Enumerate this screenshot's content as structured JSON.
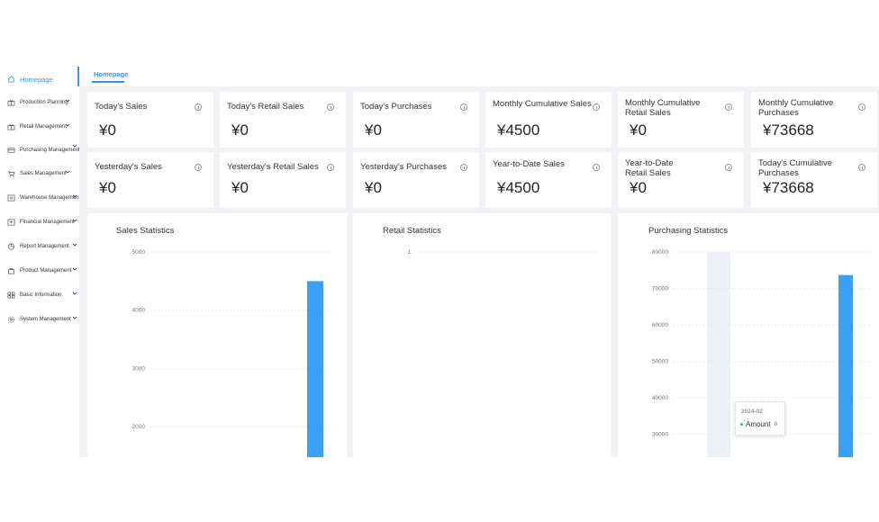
{
  "sidebar": {
    "items": [
      {
        "label": "Homepage",
        "icon": "home-icon",
        "active": true
      },
      {
        "label": "Production Planning",
        "icon": "gift-icon"
      },
      {
        "label": "Retail Management",
        "icon": "gift-icon"
      },
      {
        "label": "Purchasing Management",
        "icon": "card-icon"
      },
      {
        "label": "Sales Management",
        "icon": "cart-icon"
      },
      {
        "label": "Warehouse Management",
        "icon": "warehouse-icon"
      },
      {
        "label": "Financial Management",
        "icon": "finance-icon"
      },
      {
        "label": "Report Management",
        "icon": "pie-icon"
      },
      {
        "label": "Product Management",
        "icon": "bag-icon"
      },
      {
        "label": "Basic Information",
        "icon": "grid-icon"
      },
      {
        "label": "System Management",
        "icon": "settings-icon"
      }
    ]
  },
  "tabs": [
    {
      "label": "Homepage"
    }
  ],
  "cards": [
    {
      "label": "Today's Sales",
      "value": "¥0"
    },
    {
      "label": "Today's Retail Sales",
      "value": "¥0"
    },
    {
      "label": "Today's Purchases",
      "value": "¥0"
    },
    {
      "label": "Monthly Cumulative Sales",
      "value": "¥4500"
    },
    {
      "label": "Monthly Cumulative Retail Sales",
      "value": "¥0"
    },
    {
      "label": "Monthly Cumulative Purchases",
      "value": "¥73668"
    },
    {
      "label": "Yesterday's Sales",
      "value": "¥0"
    },
    {
      "label": "Yesterday's Retail Sales",
      "value": "¥0"
    },
    {
      "label": "Yesterday's Purchases",
      "value": "¥0"
    },
    {
      "label": "Year-to-Date Sales",
      "value": "¥4500"
    },
    {
      "label": "Year-to-Date Retail Sales",
      "value": "¥0"
    },
    {
      "label": "Today's Cumulative Purchases",
      "value": "¥73668"
    }
  ],
  "colors": {
    "accent": "#3d8ff2",
    "bar": "#3a9ff6",
    "background": "#f0f2f5"
  },
  "chart_data": [
    {
      "type": "bar",
      "title": "Sales Statistics",
      "ylim": [
        2000,
        5000
      ],
      "ticks": [
        5000,
        4000,
        3000,
        2000
      ],
      "series": [
        {
          "values": [
            4500
          ]
        }
      ],
      "grid": true
    },
    {
      "type": "bar",
      "title": "Retail Statistics",
      "ticks": [
        1
      ],
      "series": [
        {
          "values": []
        }
      ],
      "grid": true
    },
    {
      "type": "bar",
      "title": "Purchasing Statistics",
      "ylim": [
        30000,
        80000
      ],
      "ticks": [
        80000,
        70000,
        60000,
        50000,
        40000,
        30000
      ],
      "series": [
        {
          "values": [
            73668
          ]
        }
      ],
      "grid": true,
      "tooltip": {
        "title": "2024-02",
        "series": "Amount",
        "value": "0"
      }
    }
  ]
}
